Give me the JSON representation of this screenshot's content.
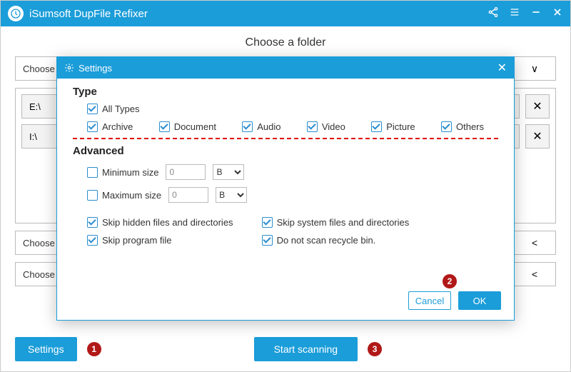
{
  "app": {
    "title": "iSumsoft DupFile Refixer"
  },
  "page": {
    "subtitle": "Choose a folder",
    "choose_label": "Choose"
  },
  "folders": {
    "items": [
      "E:\\",
      "I:\\"
    ]
  },
  "footer": {
    "settings_label": "Settings",
    "start_label": "Start scanning",
    "badges": {
      "settings": "1",
      "ok": "2",
      "start": "3"
    }
  },
  "modal": {
    "title": "Settings",
    "type_section": "Type",
    "all_types": "All Types",
    "types": [
      "Archive",
      "Document",
      "Audio",
      "Video",
      "Picture",
      "Others"
    ],
    "advanced_section": "Advanced",
    "min_size_label": "Minimum size",
    "max_size_label": "Maximum size",
    "size_value": "0",
    "size_unit": "B",
    "skip_hidden": "Skip hidden files and directories",
    "skip_system": "Skip system files and directories",
    "skip_program": "Skip program file",
    "no_recycle": "Do not scan recycle bin.",
    "cancel": "Cancel",
    "ok": "OK"
  }
}
